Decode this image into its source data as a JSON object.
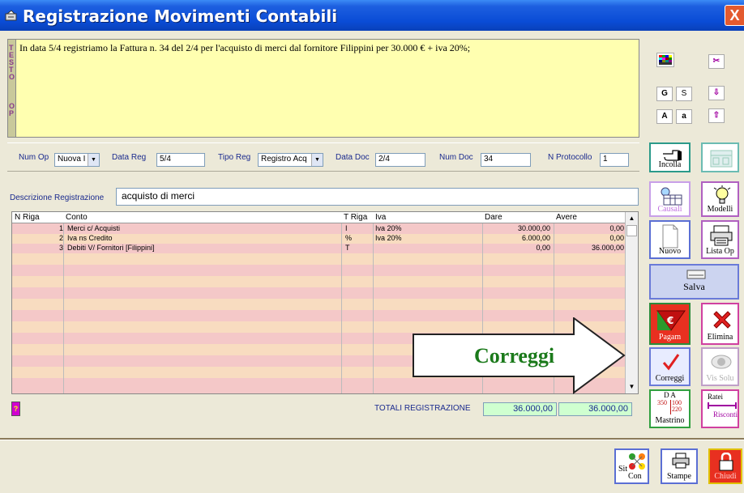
{
  "window": {
    "title": "Registrazione Movimenti Contabili",
    "close_label": "X"
  },
  "note": {
    "strip_letters": [
      "T",
      "E",
      "S",
      "T",
      "O",
      "",
      "O",
      "P"
    ],
    "text": "In data 5/4 registriamo la Fattura n. 34 del 2/4 per l'acquisto di merci dal fornitore Filippini per 30.000 € + iva 20%;"
  },
  "format_toolbar": {
    "bold_label": "G",
    "s_label": "S",
    "upper_label": "A",
    "lower_label": "a"
  },
  "form": {
    "num_op_label": "Num Op",
    "num_op_value": "Nuova I",
    "data_reg_label": "Data Reg",
    "data_reg_value": "5/4",
    "tipo_reg_label": "Tipo Reg",
    "tipo_reg_value": "Registro Acq",
    "data_doc_label": "Data Doc",
    "data_doc_value": "2/4",
    "num_doc_label": "Num Doc",
    "num_doc_value": "34",
    "protocollo_label": "N Protocollo",
    "protocollo_value": "1"
  },
  "description": {
    "label": "Descrizione Registrazione",
    "value": "acquisto di merci"
  },
  "grid": {
    "headers": [
      "N Riga",
      "Conto",
      "T Riga",
      "Iva",
      "Dare",
      "Avere"
    ],
    "rows": [
      {
        "n": "1",
        "conto": "Merci c/ Acquisti",
        "t": "I",
        "iva": "Iva 20%",
        "dare": "30.000,00",
        "avere": "0,00"
      },
      {
        "n": "2",
        "conto": "Iva ns Credito",
        "t": "%",
        "iva": "Iva 20%",
        "dare": "6.000,00",
        "avere": "0,00"
      },
      {
        "n": "3",
        "conto": "Debiti V/ Fornitori [Filippini]",
        "t": "T",
        "iva": "",
        "dare": "0,00",
        "avere": "36.000,00"
      }
    ]
  },
  "totals": {
    "label": "TOTALI REGISTRAZIONE",
    "dare": "36.000,00",
    "avere": "36.000,00",
    "help_label": "?"
  },
  "side_buttons": {
    "incolla": "Incolla",
    "causali": "Causali",
    "modelli": "Modelli",
    "nuovo": "Nuovo",
    "lista_op": "Lista Op",
    "salva": "Salva",
    "pagam": "Pagam",
    "elimina": "Elimina",
    "correggi": "Correggi",
    "vis_solu": "Vis Solu",
    "mastrino_top": "D  A",
    "mastrino": "Mastrino",
    "mastrino_nums": [
      "350",
      "100",
      "220"
    ],
    "ratei": "Ratei",
    "risconti": "Risconti"
  },
  "bottom_buttons": {
    "sit_con_1": "Sit",
    "sit_con_2": "Con",
    "stampe": "Stampe",
    "chiudi": "Chiudi"
  },
  "annotation": {
    "text": "Correggi"
  },
  "colors": {
    "title_bar": "#0a4cd6",
    "note_bg": "#ffffb0",
    "grid_pink": "#f4c8c8",
    "grid_peach": "#f8dcc0",
    "totals_bg": "#cfffd0",
    "annotation_green": "#1b7a1b",
    "close_red": "#e35a2f"
  }
}
